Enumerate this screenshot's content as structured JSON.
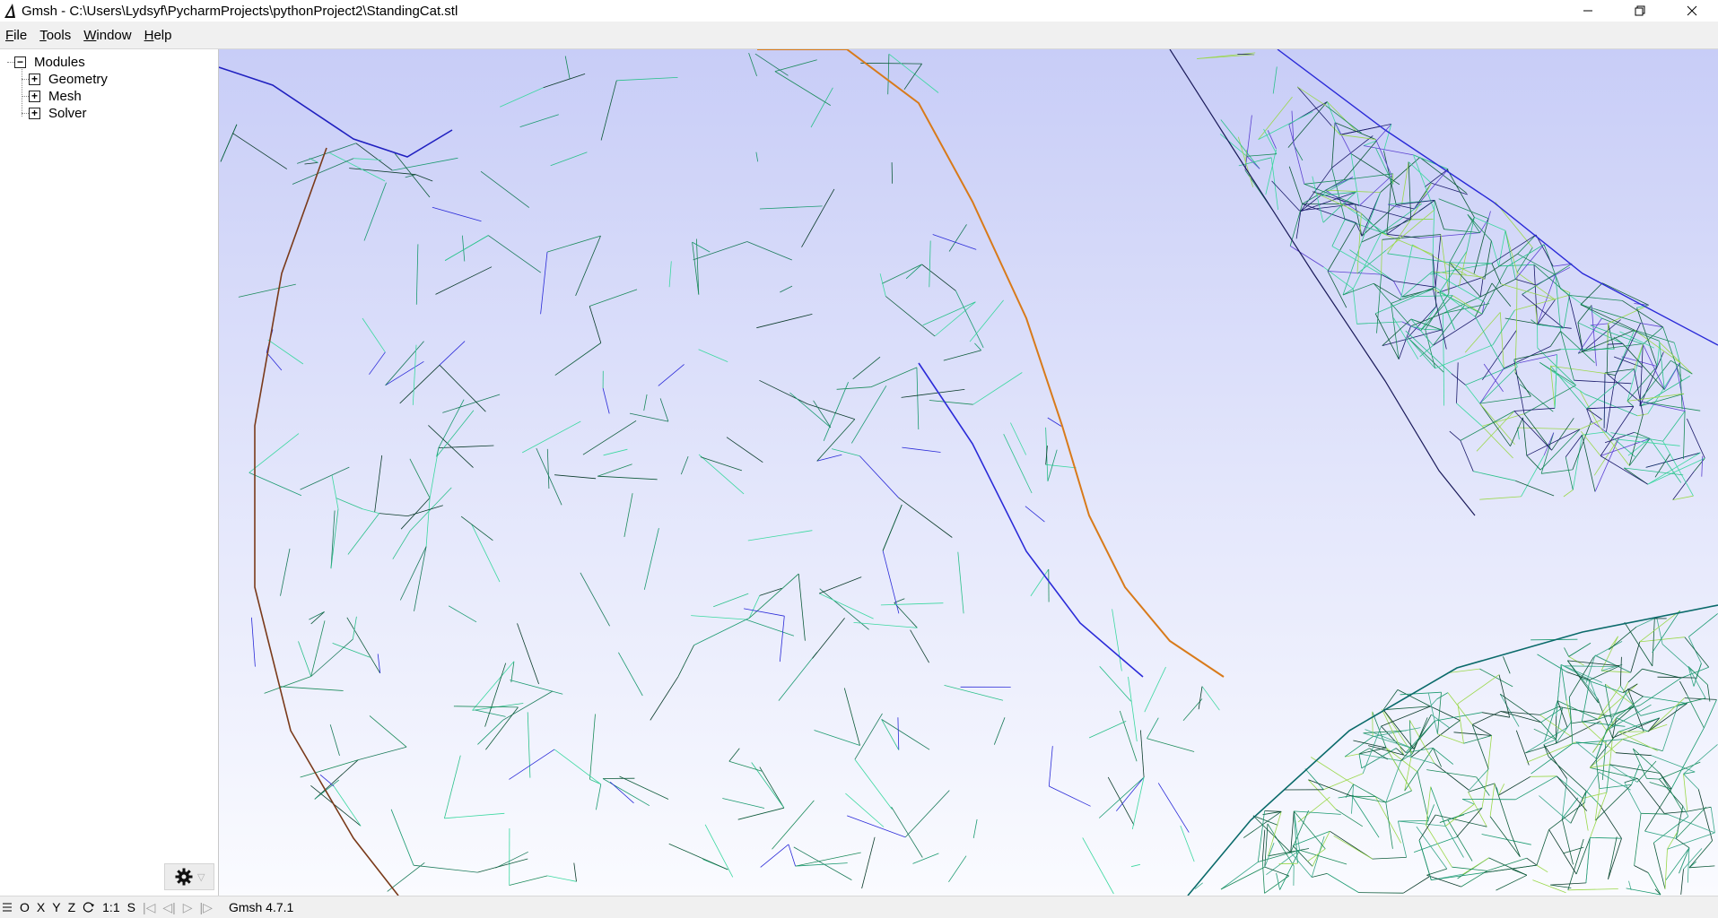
{
  "window": {
    "title": "Gmsh - C:\\Users\\Lydsyf\\PycharmProjects\\pythonProject2\\StandingCat.stl"
  },
  "menu": {
    "items": [
      {
        "label": "File",
        "accel": "F",
        "rest": "ile"
      },
      {
        "label": "Tools",
        "accel": "T",
        "rest": "ools"
      },
      {
        "label": "Window",
        "accel": "W",
        "rest": "indow"
      },
      {
        "label": "Help",
        "accel": "H",
        "rest": "elp"
      }
    ]
  },
  "tree": {
    "root": "Modules",
    "children": [
      "Geometry",
      "Mesh",
      "Solver"
    ]
  },
  "statusbar": {
    "buttons": [
      "O",
      "X",
      "Y",
      "Z",
      "1:1",
      "S"
    ],
    "version": "Gmsh 4.7.1"
  },
  "colors": {
    "viewport_top": "#c8cdf7",
    "viewport_bottom": "#fafbff",
    "mesh_green": "#1a8a5a",
    "mesh_blue": "#2a2ad8",
    "mesh_orange": "#d87a1a",
    "mesh_brown": "#7a3a1a"
  },
  "icons": {
    "app": "gmsh-triangle-icon",
    "settings": "gear-icon"
  }
}
